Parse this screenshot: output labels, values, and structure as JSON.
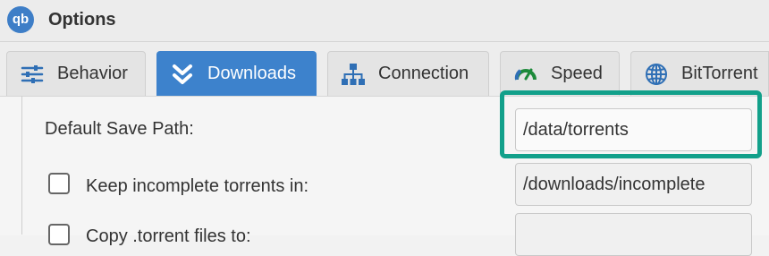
{
  "window": {
    "title": "Options",
    "app_icon_text": "qb",
    "app_icon": "qbittorrent-logo-icon"
  },
  "tabs": [
    {
      "label": "Behavior",
      "icon": "sliders-icon",
      "active": false
    },
    {
      "label": "Downloads",
      "icon": "double-chevron-down-icon",
      "active": true
    },
    {
      "label": "Connection",
      "icon": "network-icon",
      "active": false
    },
    {
      "label": "Speed",
      "icon": "speedometer-icon",
      "active": false
    },
    {
      "label": "BitTorrent",
      "icon": "globe-icon",
      "active": false
    }
  ],
  "downloads": {
    "default_save_path": {
      "label": "Default Save Path:",
      "value": "/data/torrents"
    },
    "keep_incomplete": {
      "label": "Keep incomplete torrents in:",
      "checked": false,
      "value": "/downloads/incomplete"
    },
    "copy_torrent_files": {
      "label": "Copy .torrent files to:",
      "checked": false,
      "value": ""
    }
  },
  "colors": {
    "accent": "#3d82cc",
    "highlight": "#12a08a"
  }
}
